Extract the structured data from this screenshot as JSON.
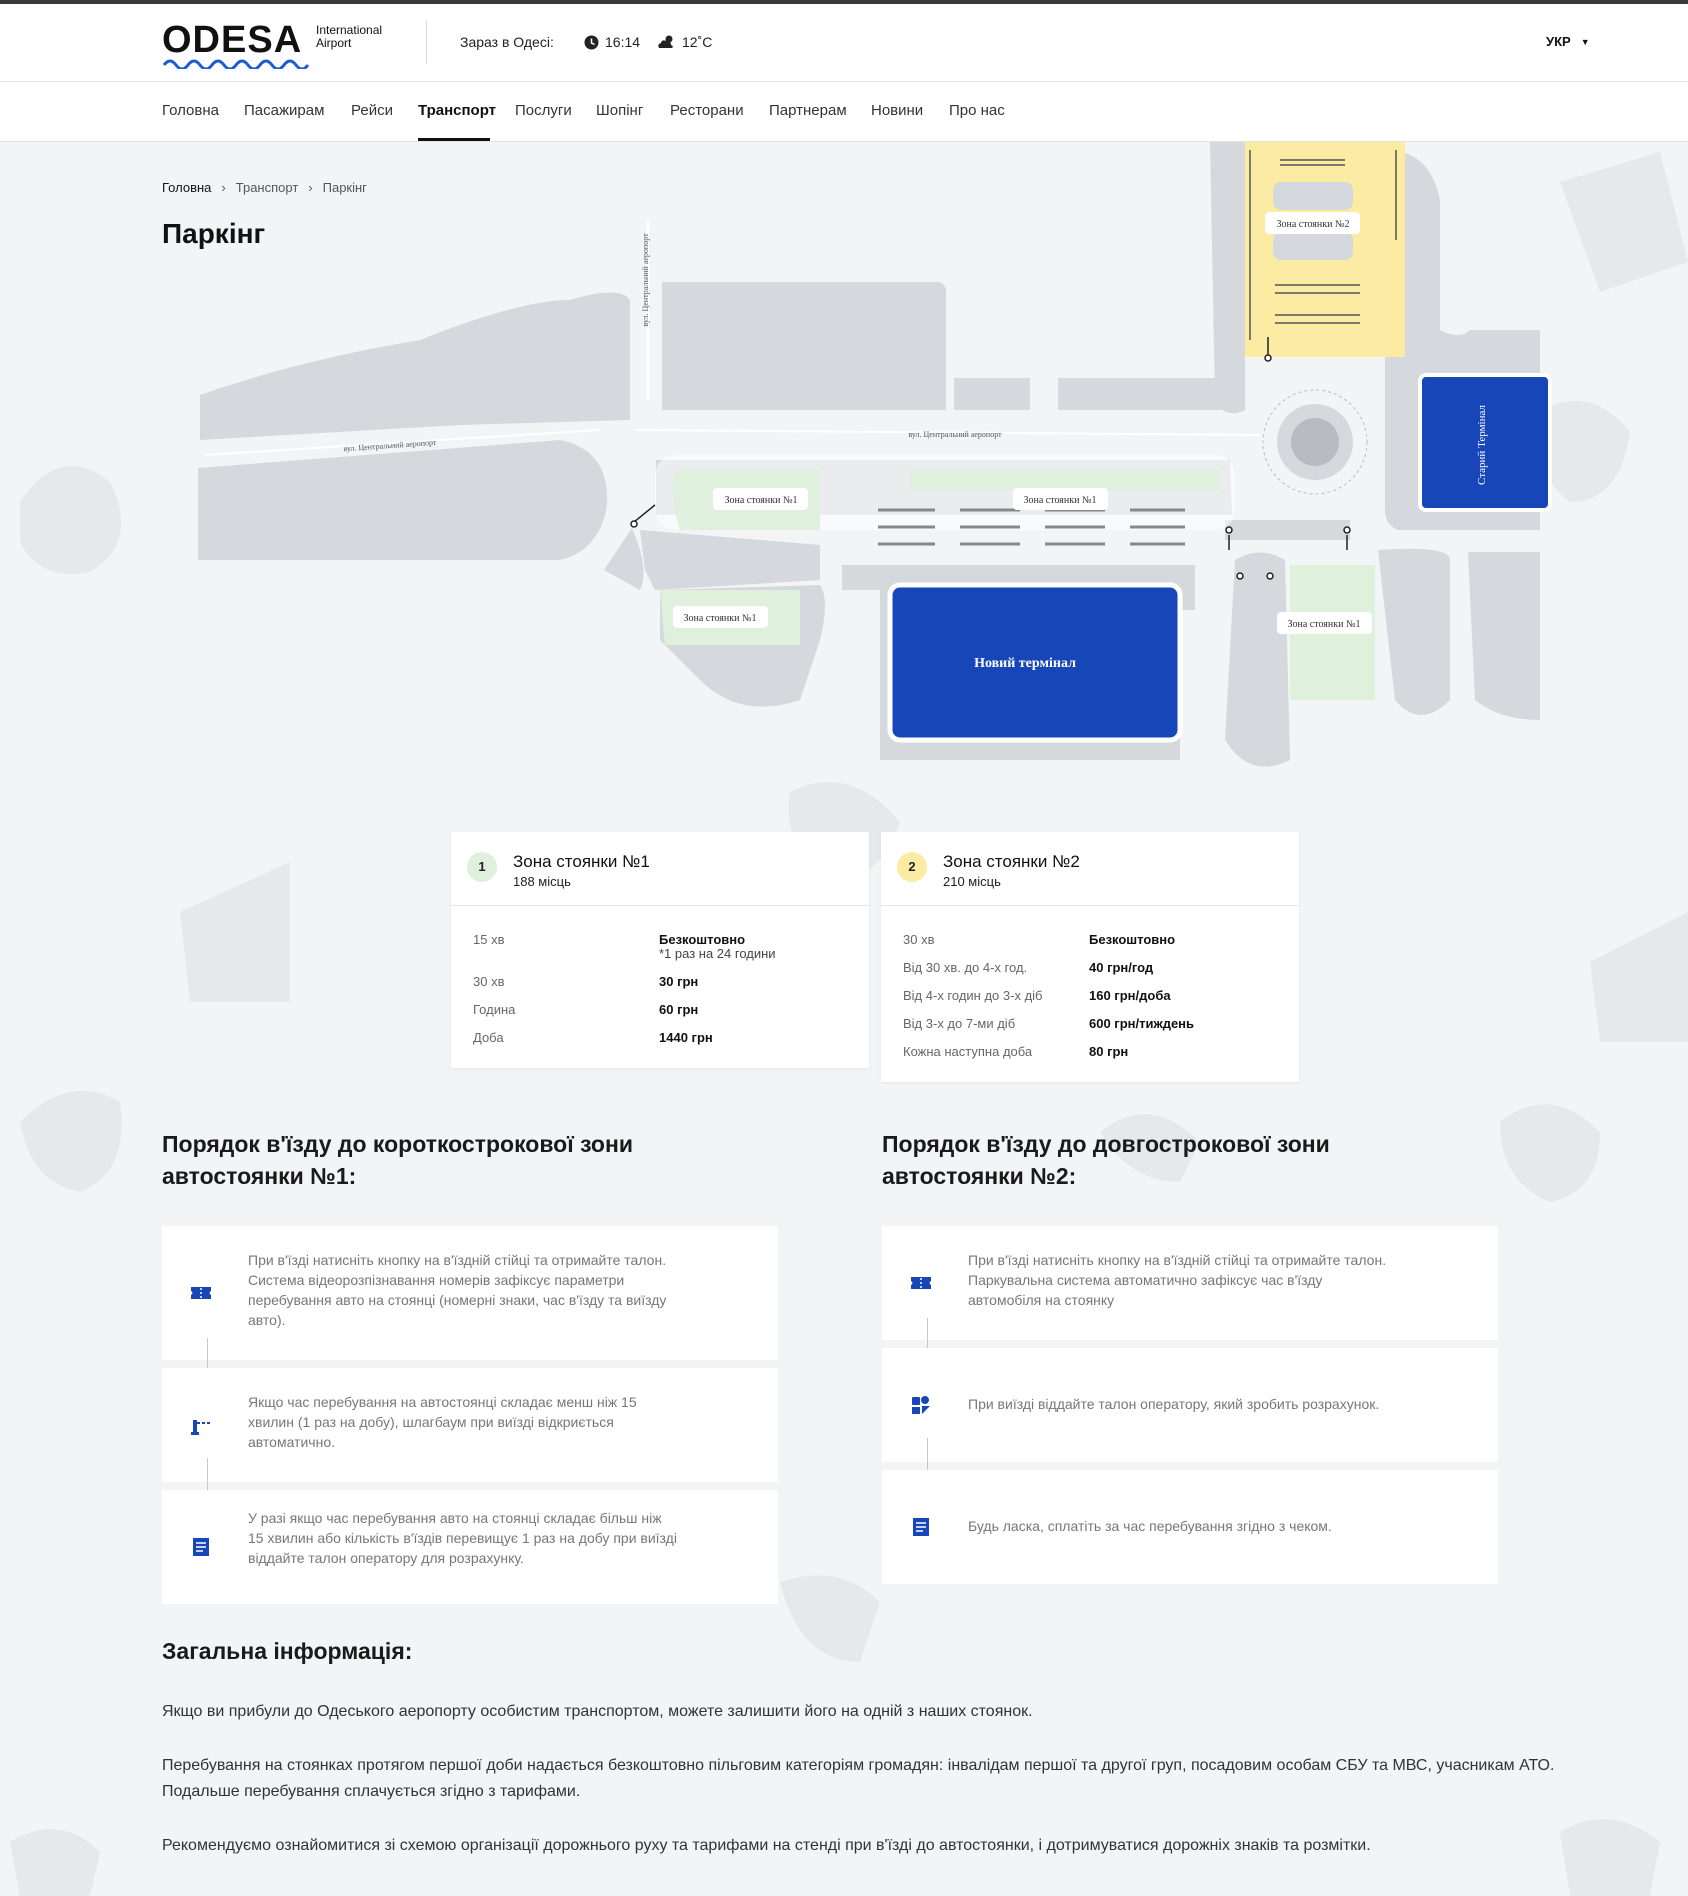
{
  "header": {
    "logo_word": "ODESA",
    "logo_sub": "International Airport",
    "now_label": "Зараз в Одесі:",
    "time": "16:14",
    "temperature": "12˚C",
    "language": "УКР"
  },
  "nav": {
    "items": [
      {
        "label": "Головна"
      },
      {
        "label": "Пасажирам"
      },
      {
        "label": "Рейси"
      },
      {
        "label": "Транспорт"
      },
      {
        "label": "Послуги"
      },
      {
        "label": "Шопінг"
      },
      {
        "label": "Ресторани"
      },
      {
        "label": "Партнерам"
      },
      {
        "label": "Новини"
      },
      {
        "label": "Про нас"
      }
    ],
    "active": "Транспорт"
  },
  "breadcrumb": [
    "Головна",
    "Транспорт",
    "Паркінг"
  ],
  "page_title": "Паркінг",
  "map": {
    "street_vertical": "вул. Центральний аеропорт",
    "street_left": "вул. Центральний аеропорт",
    "street_center": "вул. Центральний аеропорт",
    "zone2_label": "Зона стоянки №2",
    "zone1_label": "Зона стоянки №1",
    "new_terminal": "Новий термінал",
    "old_terminal": "Старий Термінал",
    "colors": {
      "terminal": "#1746b8",
      "zone1": "#dff0dc",
      "zone2": "#fbeba3",
      "land": "#d5d8dc"
    }
  },
  "zones": [
    {
      "num": "1",
      "name": "Зона стоянки №1",
      "capacity": "188 місць",
      "color": "#dff0dc",
      "tariffs": [
        {
          "k": "15 хв",
          "v": "Безкоштовно",
          "note": "*1 раз на 24 години"
        },
        {
          "k": "30 хв",
          "v": "30 грн"
        },
        {
          "k": "Година",
          "v": "60 грн"
        },
        {
          "k": "Доба",
          "v": "1440 грн"
        }
      ]
    },
    {
      "num": "2",
      "name": "Зона стоянки №2",
      "capacity": "210 місць",
      "color": "#fbeba3",
      "tariffs": [
        {
          "k": "30 хв",
          "v": "Безкоштовно"
        },
        {
          "k": "Від 30 хв. до 4-х год.",
          "v": "40 грн/год"
        },
        {
          "k": "Від 4-х годин до 3-х діб",
          "v": "160 грн/доба"
        },
        {
          "k": "Від 3-х до 7-ми діб",
          "v": "600 грн/тиждень"
        },
        {
          "k": "Кожна наступна доба",
          "v": "80 грн"
        }
      ]
    }
  ],
  "entry_short": {
    "title": "Порядок в'їзду до короткострокової зони автостоянки №1:",
    "steps": [
      {
        "icon": "ticket-icon",
        "text": "При в'їзді натисніть кнопку на в'їздній стійці та отримайте талон. Система відеорозпізнавання номерів зафіксує параметри перебування авто на стоянці (номерні знаки, час в'їзду та виїзду авто)."
      },
      {
        "icon": "barrier-icon",
        "text": "Якщо час перебування на автостоянці складає менш ніж 15 хвилин (1 раз на добу), шлагбаум при виїзді відкриється автоматично."
      },
      {
        "icon": "receipt-icon",
        "text": "У разі якщо час перебування авто на стоянці складає більш ніж 15 хвилин або кількість в'їздів перевищує 1 раз на добу при виїзді віддайте талон оператору для розрахунку."
      }
    ]
  },
  "entry_long": {
    "title": "Порядок в'їзду до довгострокової зони автостоянки №2:",
    "steps": [
      {
        "icon": "ticket-icon",
        "text": "При в'їзді натисніть кнопку на в'їздній стійці та отримайте талон. Паркувальна система автоматично зафіксує час в'їзду автомобіля на стоянку"
      },
      {
        "icon": "operator-icon",
        "text": "При виїзді віддайте талон оператору, який зробить розрахунок."
      },
      {
        "icon": "receipt-icon",
        "text": "Будь ласка, сплатіть за час перебування згідно з чеком."
      }
    ]
  },
  "general": {
    "title": "Загальна інформація:",
    "paragraphs": [
      "Якщо ви прибули до Одеського аеропорту особистим транспортом, можете залишити його на одній з наших стоянок.",
      "Перебування на стоянках протягом першої доби надається безкоштовно пільговим категоріям громадян: інвалідам першої та другої груп, посадовим особам СБУ та МВС, учасникам АТО. Подальше перебування сплачується згідно з тарифами.",
      "Рекомендуємо ознайомитися зі схемою організації дорожнього руху та тарифами на стенді при в'їзді до автостоянки, і дотримуватися дорожніх знаків та розмітки."
    ]
  },
  "accent": "#1746b8"
}
